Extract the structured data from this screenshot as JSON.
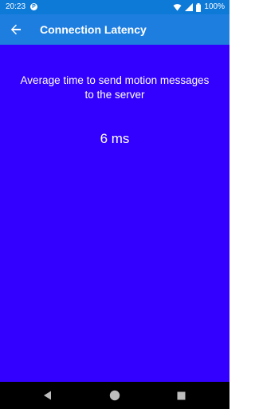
{
  "status_bar": {
    "time": "20:23",
    "notification_glyph": "P",
    "battery": "100%",
    "icons": [
      "wifi-icon",
      "cellular-icon",
      "battery-icon"
    ]
  },
  "app_bar": {
    "title": "Connection Latency",
    "back_icon": "arrow-back-icon"
  },
  "content": {
    "description": "Average time to send motion messages to the server",
    "latency": "6 ms"
  },
  "nav_bar": {
    "buttons": [
      "back-triangle-icon",
      "home-circle-icon",
      "recents-square-icon"
    ]
  },
  "colors": {
    "status_bar": "#0e7ad8",
    "app_bar": "#1e7ee0",
    "background": "#3300ff",
    "nav_bar": "#000000",
    "text": "#ffffff"
  }
}
